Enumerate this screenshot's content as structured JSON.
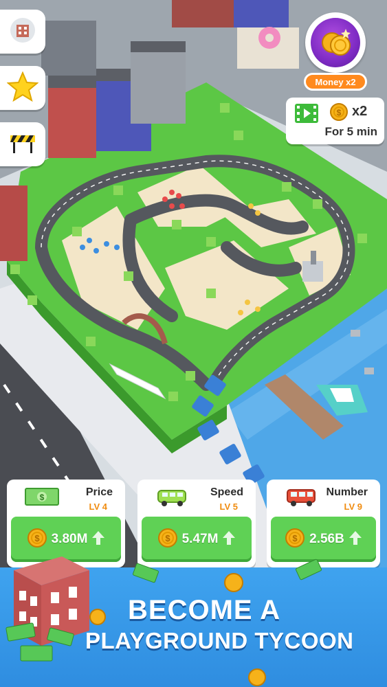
{
  "sidebar": {
    "items": [
      {
        "icon": "building-icon"
      },
      {
        "icon": "star-icon"
      },
      {
        "icon": "roadblock-icon"
      }
    ]
  },
  "boost": {
    "label": "Money x2",
    "icon": "coins-icon"
  },
  "ad_offer": {
    "icon": "video-icon",
    "multiplier": "x2",
    "duration": "For 5 min"
  },
  "upgrades": [
    {
      "name": "Price",
      "level": "LV 4",
      "cost": "3.80M",
      "icon": "cash-icon"
    },
    {
      "name": "Speed",
      "level": "LV 5",
      "cost": "5.47M",
      "icon": "van-icon"
    },
    {
      "name": "Number",
      "level": "LV 9",
      "cost": "2.56B",
      "icon": "bus-icon"
    }
  ],
  "banner": {
    "line1": "BECOME A",
    "line2": "PLAYGROUND TYCOON"
  },
  "colors": {
    "grass": "#5cc745",
    "road": "#55585e",
    "water": "#4fa7e8",
    "accent_orange": "#ff8a1e",
    "buy_green": "#5fd155",
    "banner_blue": "#3596e8",
    "boost_purple": "#7e2bc4"
  }
}
